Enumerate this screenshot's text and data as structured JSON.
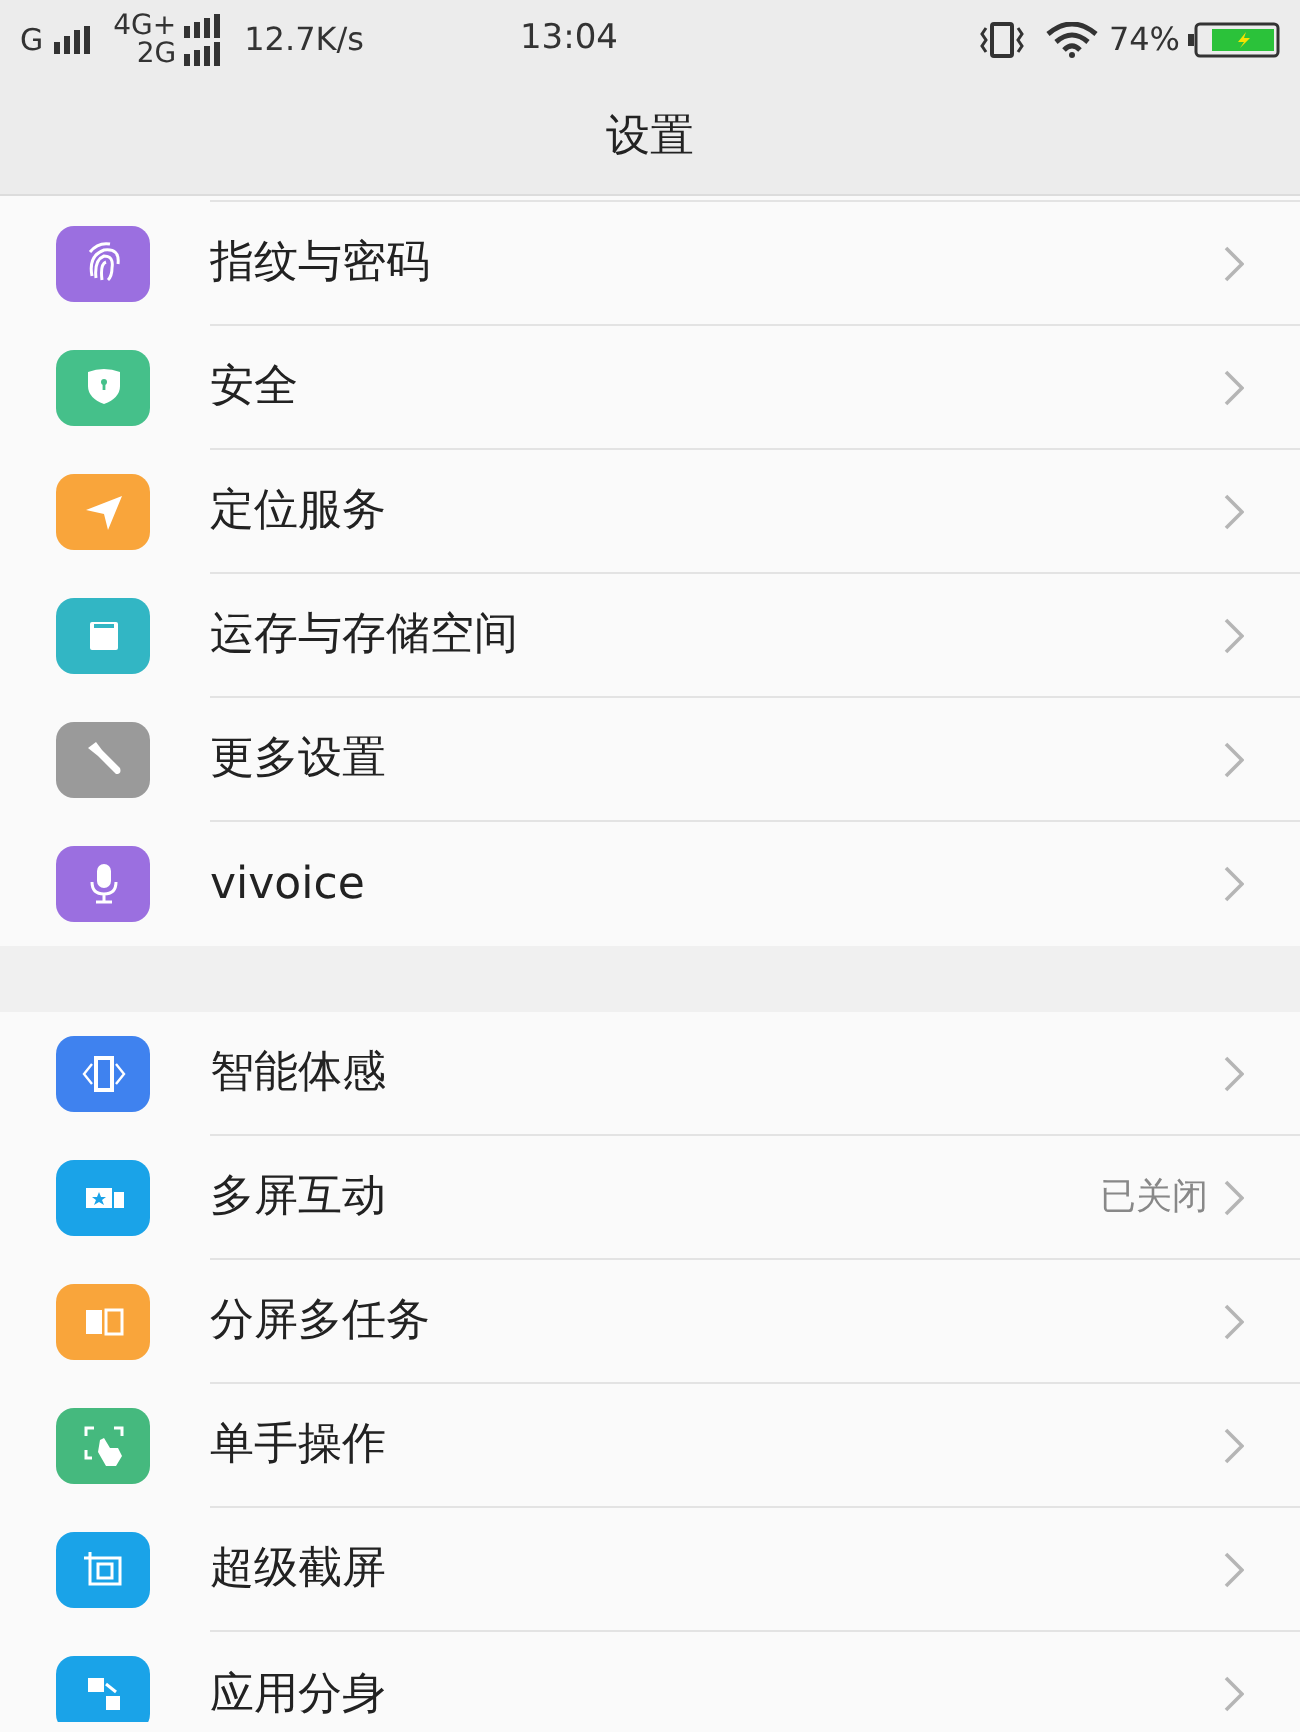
{
  "status_bar": {
    "carrier_1": "G",
    "carrier_2_top": "4G+",
    "carrier_2_bottom": "2G",
    "speed": "12.7K/s",
    "time": "13:04",
    "battery": "74%"
  },
  "header": {
    "title": "设置"
  },
  "groups": [
    {
      "items": [
        {
          "label": "指纹与密码",
          "kind": "fingerprint",
          "color": "#9b6fe0"
        },
        {
          "label": "安全",
          "kind": "shield",
          "color": "#45c08a"
        },
        {
          "label": "定位服务",
          "kind": "location",
          "color": "#f9a53b"
        },
        {
          "label": "运存与存储空间",
          "kind": "storage",
          "color": "#32b6c4"
        },
        {
          "label": "更多设置",
          "kind": "wrench",
          "color": "#9a9a9a"
        },
        {
          "label": "vivoice",
          "kind": "mic",
          "color": "#9b6fe0"
        }
      ]
    },
    {
      "items": [
        {
          "label": "智能体感",
          "kind": "phone",
          "color": "#3f82ef"
        },
        {
          "label": "多屏互动",
          "kind": "screens",
          "color": "#1aa3e8",
          "value": "已关闭"
        },
        {
          "label": "分屏多任务",
          "kind": "split",
          "color": "#f9a53b"
        },
        {
          "label": "单手操作",
          "kind": "hand",
          "color": "#45b97e"
        },
        {
          "label": "超级截屏",
          "kind": "screenshot",
          "color": "#1aa3e8"
        },
        {
          "label": "应用分身",
          "kind": "clone",
          "color": "#1aa3e8"
        }
      ]
    }
  ]
}
